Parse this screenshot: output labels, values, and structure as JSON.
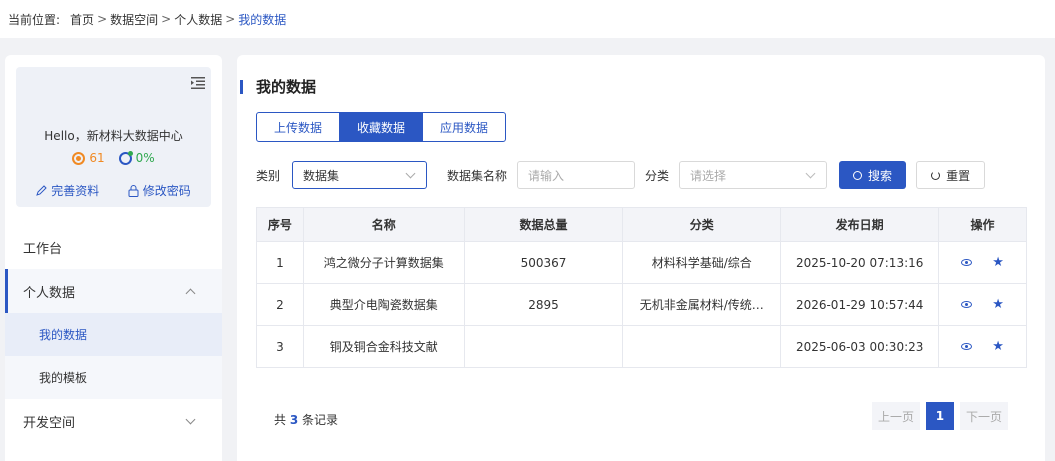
{
  "breadcrumb": {
    "prefix": "当前位置:",
    "items": [
      "首页",
      "数据空间",
      "个人数据"
    ],
    "separator": ">",
    "current": "我的数据"
  },
  "profile": {
    "greeting": "Hello，新材料大数据中心",
    "coins": "61",
    "percent": "0%",
    "edit_profile": "完善资料",
    "change_password": "修改密码"
  },
  "menu": {
    "workbench": "工作台",
    "personal_data": "个人数据",
    "my_data": "我的数据",
    "my_templates": "我的模板",
    "dev_space": "开发空间"
  },
  "main": {
    "title": "我的数据",
    "tabs": [
      {
        "label": "上传数据",
        "active": false
      },
      {
        "label": "收藏数据",
        "active": true
      },
      {
        "label": "应用数据",
        "active": false
      }
    ]
  },
  "filters": {
    "category_label": "类别",
    "category_value": "数据集",
    "name_label": "数据集名称",
    "name_placeholder": "请输入",
    "class_label": "分类",
    "class_placeholder": "请选择",
    "search_button": "搜索",
    "reset_button": "重置"
  },
  "table": {
    "headers": [
      "序号",
      "名称",
      "数据总量",
      "分类",
      "发布日期",
      "操作"
    ],
    "rows": [
      {
        "index": "1",
        "name": "鸿之微分子计算数据集",
        "total": "500367",
        "category": "材料科学基础/综合",
        "date": "2025-10-20 07:13:16"
      },
      {
        "index": "2",
        "name": "典型介电陶瓷数据集",
        "total": "2895",
        "category": "无机非金属材料/传统…",
        "date": "2026-01-29 10:57:44"
      },
      {
        "index": "3",
        "name": "铜及铜合金科技文献",
        "total": "",
        "category": "",
        "date": "2025-06-03 00:30:23"
      }
    ]
  },
  "footer": {
    "total_prefix": "共",
    "total_count": "3",
    "total_suffix": "条记录",
    "prev": "上一页",
    "page": "1",
    "next": "下一页"
  },
  "colors": {
    "accent": "#2b57c3",
    "coin": "#f08a24",
    "percent": "#2fa84f"
  }
}
